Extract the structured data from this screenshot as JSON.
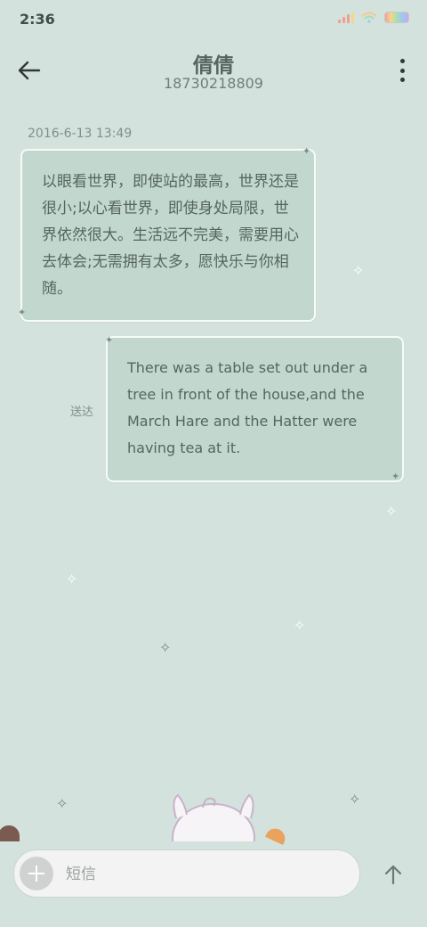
{
  "status_bar": {
    "time": "2:36"
  },
  "header": {
    "contact_name": "倩倩",
    "contact_number": "18730218809"
  },
  "conversation": {
    "timestamp": "2016-6-13 13:49",
    "messages": [
      {
        "direction": "incoming",
        "text": "以眼看世界，即使站的最高，世界还是很小;以心看世界，即使身处局限，世界依然很大。生活远不完美，需要用心去体会;无需拥有太多，愿快乐与你相随。"
      },
      {
        "direction": "outgoing",
        "text": "There was a table set out under a tree in front of the house,and the March Hare and the Hatter were having tea at it.",
        "status": "送达"
      }
    ]
  },
  "composer": {
    "placeholder": "短信"
  },
  "icons": {
    "back": "arrow-left-icon",
    "more": "more-vertical-icon",
    "attach": "plus-icon",
    "send": "arrow-up-icon"
  },
  "colors": {
    "background": "#d3e2dd",
    "bubble": "#c2d8cf",
    "bubble_border": "#f6fbf9",
    "text": "#56655f"
  }
}
